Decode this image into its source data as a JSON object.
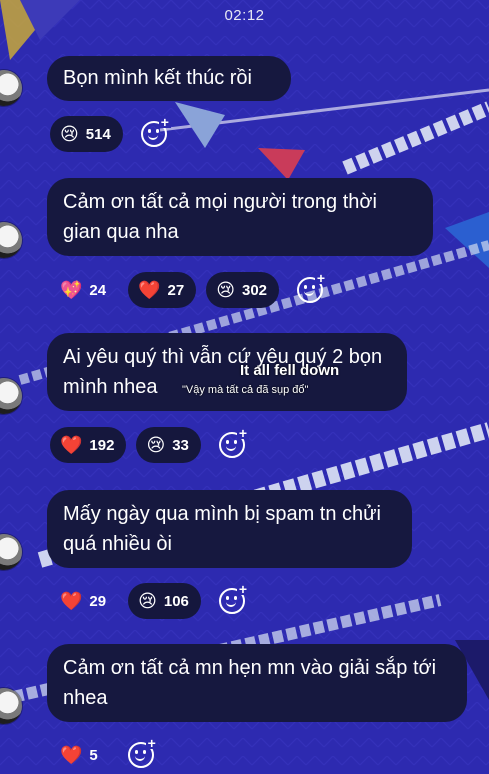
{
  "status_bar": {
    "time": "02:12"
  },
  "messages": [
    {
      "text": "Bọn mình kết thúc rồi",
      "reactions": [
        {
          "emoji": "😢",
          "icon": "crying-face-icon",
          "count": "514"
        }
      ]
    },
    {
      "text": "Cảm ơn tất cả mọi người trong thời gian qua nha",
      "reactions": [
        {
          "emoji": "💖",
          "icon": "sparkling-heart-icon",
          "count": "24"
        },
        {
          "emoji": "❤️",
          "icon": "red-heart-icon",
          "count": "27"
        },
        {
          "emoji": "😢",
          "icon": "crying-face-icon",
          "count": "302"
        }
      ]
    },
    {
      "text": "Ai yêu quý thì vẫn cứ yêu quý 2 bọn mình nhea",
      "reactions": [
        {
          "emoji": "❤️",
          "icon": "red-heart-icon",
          "count": "192"
        },
        {
          "emoji": "😢",
          "icon": "crying-face-icon",
          "count": "33"
        }
      ]
    },
    {
      "text": "Mấy ngày qua mình bị spam tn chửi quá nhiều òi",
      "reactions": [
        {
          "emoji": "❤️",
          "icon": "red-heart-icon",
          "count": "29"
        },
        {
          "emoji": "😢",
          "icon": "crying-face-icon",
          "count": "106"
        }
      ]
    },
    {
      "text": "Cảm ơn tất cả mn hẹn mn vào giải sắp tới nhea",
      "reactions": [
        {
          "emoji": "❤️",
          "icon": "red-heart-icon",
          "count": "5"
        }
      ]
    }
  ],
  "subtitle": {
    "line1": "It all fell down",
    "line2": "\"Vậy mà tất cả đã sụp đổ\""
  },
  "colors": {
    "background": "#2d2ab0",
    "bubble": "#16183f",
    "text": "#ffffff"
  }
}
